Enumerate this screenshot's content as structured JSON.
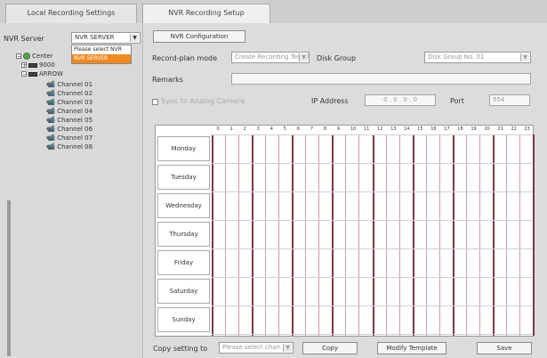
{
  "tabs": [
    "Local Recording Settings",
    "NVR Recording Setup"
  ],
  "left": {
    "server_label": "NVR Server",
    "server_value": "NVR SERVER",
    "dropdown_options": [
      "Please select NVR",
      "NVR SERVER"
    ],
    "tree": {
      "root": "Center",
      "nodes": [
        "9000",
        "ARROW"
      ],
      "channels": [
        "Channel 01",
        "Channel 02",
        "Channel 03",
        "Channel 04",
        "Channel 05",
        "Channel 06",
        "Channel 07",
        "Channel 08"
      ]
    }
  },
  "main": {
    "config_button": "NVR Configuration",
    "record_plan_label": "Record-plan mode",
    "record_plan_value": "Create Recording Template",
    "disk_group_label": "Disk Group",
    "disk_group_value": "Disk Group No. 01",
    "remarks_label": "Remarks",
    "sync_label": "Sync to Analog Camera",
    "ip_label": "IP Address",
    "ip_value": "0 . 0 . 0 . 0",
    "port_label": "Port",
    "port_value": "554",
    "days": [
      "Monday",
      "Tuesday",
      "Wednesday",
      "Thursday",
      "Friday",
      "Saturday",
      "Sunday"
    ],
    "hours": [
      "0",
      "1",
      "2",
      "3",
      "4",
      "5",
      "6",
      "7",
      "8",
      "9",
      "10",
      "11",
      "12",
      "13",
      "14",
      "15",
      "16",
      "17",
      "18",
      "19",
      "20",
      "21",
      "22",
      "23"
    ],
    "copy_to_label": "Copy setting to",
    "copy_select_placeholder": "Please select chan",
    "copy_button": "Copy",
    "modify_button": "Modify Template",
    "save_button": "Save"
  }
}
